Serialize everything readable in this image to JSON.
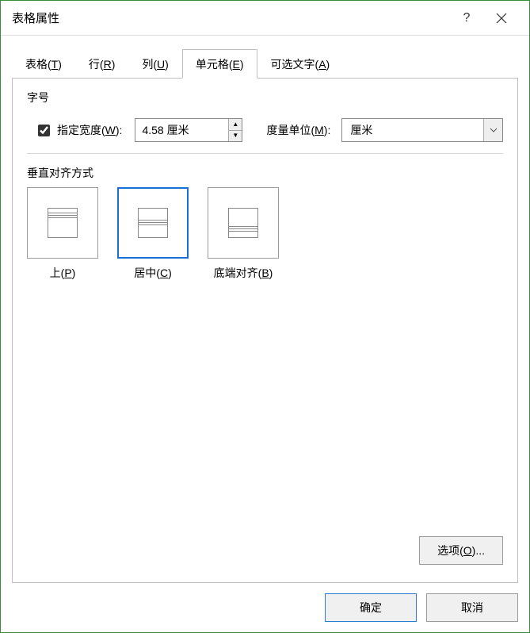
{
  "title": "表格属性",
  "tabs": [
    {
      "label": "表格",
      "key": "T"
    },
    {
      "label": "行",
      "key": "R"
    },
    {
      "label": "列",
      "key": "U"
    },
    {
      "label": "单元格",
      "key": "E"
    },
    {
      "label": "可选文字",
      "key": "A"
    }
  ],
  "active_tab": 3,
  "size": {
    "section_label": "字号",
    "checkbox_label": "指定宽度",
    "checkbox_key": "W",
    "checkbox_checked": true,
    "value": "4.58 厘米",
    "unit_label": "度量单位",
    "unit_key": "M",
    "unit_value": "厘米"
  },
  "valign": {
    "section_label": "垂直对齐方式",
    "selected": 1,
    "options": [
      {
        "label": "上",
        "key": "P",
        "pos": "top"
      },
      {
        "label": "居中",
        "key": "C",
        "pos": "center"
      },
      {
        "label": "底端对齐",
        "key": "B",
        "pos": "bottom"
      }
    ]
  },
  "options_btn": {
    "label": "选项",
    "key": "O",
    "suffix": "..."
  },
  "footer": {
    "ok": "确定",
    "cancel": "取消"
  }
}
